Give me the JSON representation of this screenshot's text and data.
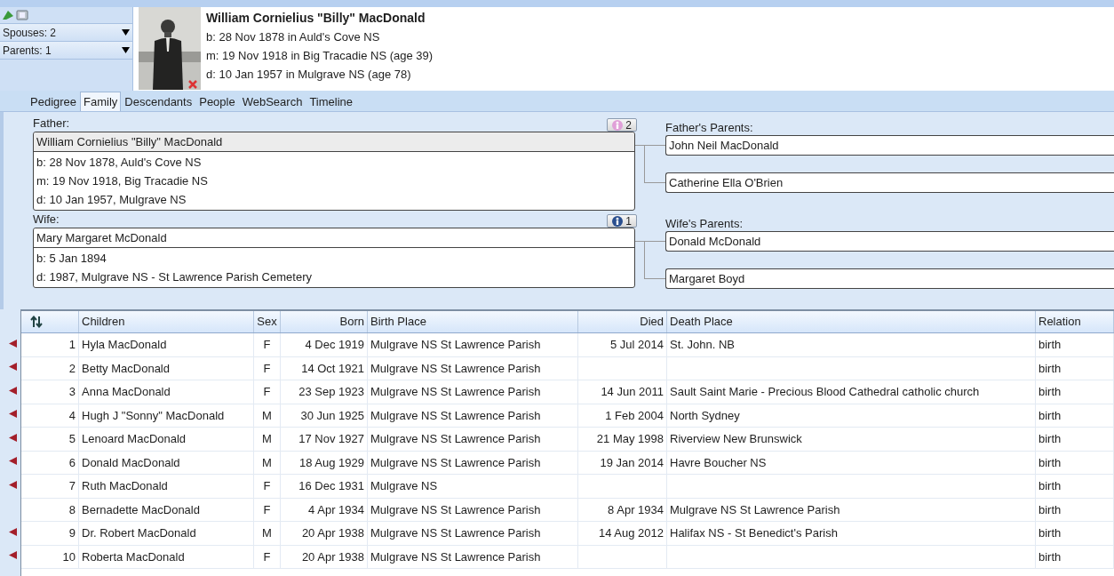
{
  "header": {
    "selectors": [
      {
        "label": "Spouses: 2"
      },
      {
        "label": "Parents: 1"
      }
    ],
    "person": {
      "name": "William Cornielius \"Billy\" MacDonald",
      "lines": [
        "b: 28 Nov 1878 in Auld's Cove NS",
        "m: 19 Nov 1918 in Big Tracadie NS (age 39)",
        "d: 10 Jan 1957 in Mulgrave NS (age 78)"
      ]
    }
  },
  "tabs": [
    {
      "label": "Pedigree",
      "selected": false
    },
    {
      "label": "Family",
      "selected": true
    },
    {
      "label": "Descendants",
      "selected": false
    },
    {
      "label": "People",
      "selected": false
    },
    {
      "label": "WebSearch",
      "selected": false
    },
    {
      "label": "Timeline",
      "selected": false
    }
  ],
  "family": {
    "couple": [
      {
        "label": "Father:",
        "count": "2",
        "kind": "male",
        "name": "William Cornielius \"Billy\" MacDonald",
        "selected": true,
        "facts": [
          "b: 28 Nov 1878, Auld's Cove NS",
          "m: 19 Nov 1918, Big Tracadie NS",
          "d: 10 Jan 1957, Mulgrave NS"
        ],
        "parents_label": "Father's Parents:",
        "parents": [
          "John Neil MacDonald",
          "Catherine Ella O'Brien"
        ]
      },
      {
        "label": "Wife:",
        "count": "1",
        "kind": "female",
        "name": "Mary Margaret McDonald",
        "selected": false,
        "facts": [
          "b: 5 Jan 1894",
          "d: 1987, Mulgrave NS - St Lawrence Parish Cemetery"
        ],
        "parents_label": "Wife's Parents:",
        "parents": [
          "Donald McDonald",
          "Margaret Boyd"
        ]
      }
    ]
  },
  "children": {
    "columns": [
      "Children",
      "Sex",
      "Born",
      "Birth Place",
      "Died",
      "Death Place",
      "Relation"
    ],
    "rows": [
      {
        "has_descendants": true,
        "num": "1",
        "name": "Hyla MacDonald",
        "sex": "F",
        "born": "4 Dec 1919",
        "birth_place": "Mulgrave NS St Lawrence Parish",
        "died": "5 Jul 2014",
        "death_place": "St. John. NB",
        "relation": "birth"
      },
      {
        "has_descendants": true,
        "num": "2",
        "name": "Betty MacDonald",
        "sex": "F",
        "born": "14 Oct 1921",
        "birth_place": "Mulgrave NS St Lawrence Parish",
        "relation": "birth"
      },
      {
        "has_descendants": true,
        "num": "3",
        "name": "Anna MacDonald",
        "sex": "F",
        "born": "23 Sep 1923",
        "birth_place": "Mulgrave NS St Lawrence Parish",
        "died": "14 Jun 2011",
        "death_place": "Sault Saint Marie - Precious Blood Cathedral catholic church",
        "relation": "birth"
      },
      {
        "has_descendants": true,
        "num": "4",
        "name": "Hugh J \"Sonny\" MacDonald",
        "sex": "M",
        "born": "30 Jun 1925",
        "birth_place": "Mulgrave NS St Lawrence Parish",
        "died": "1 Feb 2004",
        "death_place": "North Sydney",
        "relation": "birth"
      },
      {
        "has_descendants": true,
        "num": "5",
        "name": "Lenoard MacDonald",
        "sex": "M",
        "born": "17 Nov 1927",
        "birth_place": "Mulgrave NS St Lawrence Parish",
        "died": "21 May 1998",
        "death_place": "Riverview New Brunswick",
        "relation": "birth"
      },
      {
        "has_descendants": true,
        "num": "6",
        "name": "Donald MacDonald",
        "sex": "M",
        "born": "18 Aug 1929",
        "birth_place": "Mulgrave NS St Lawrence Parish",
        "died": "19 Jan 2014",
        "death_place": "Havre Boucher NS",
        "relation": "birth"
      },
      {
        "has_descendants": true,
        "num": "7",
        "name": "Ruth MacDonald",
        "sex": "F",
        "born": "16 Dec 1931",
        "birth_place": "Mulgrave NS",
        "relation": "birth"
      },
      {
        "has_descendants": false,
        "num": "8",
        "name": "Bernadette MacDonald",
        "sex": "F",
        "born": "4 Apr 1934",
        "birth_place": "Mulgrave NS St Lawrence Parish",
        "died": "8 Apr 1934",
        "death_place": "Mulgrave NS St Lawrence Parish",
        "relation": "birth"
      },
      {
        "has_descendants": true,
        "num": "9",
        "name": "Dr. Robert MacDonald",
        "sex": "M",
        "born": "20 Apr 1938",
        "birth_place": "Mulgrave NS St Lawrence Parish",
        "died": "14 Aug 2012",
        "death_place": "Halifax NS - St Benedict's Parish",
        "relation": "birth"
      },
      {
        "has_descendants": true,
        "num": "10",
        "name": "Roberta MacDonald",
        "sex": "F",
        "born": "20 Apr 1938",
        "birth_place": "Mulgrave NS St Lawrence Parish",
        "relation": "birth"
      }
    ]
  }
}
